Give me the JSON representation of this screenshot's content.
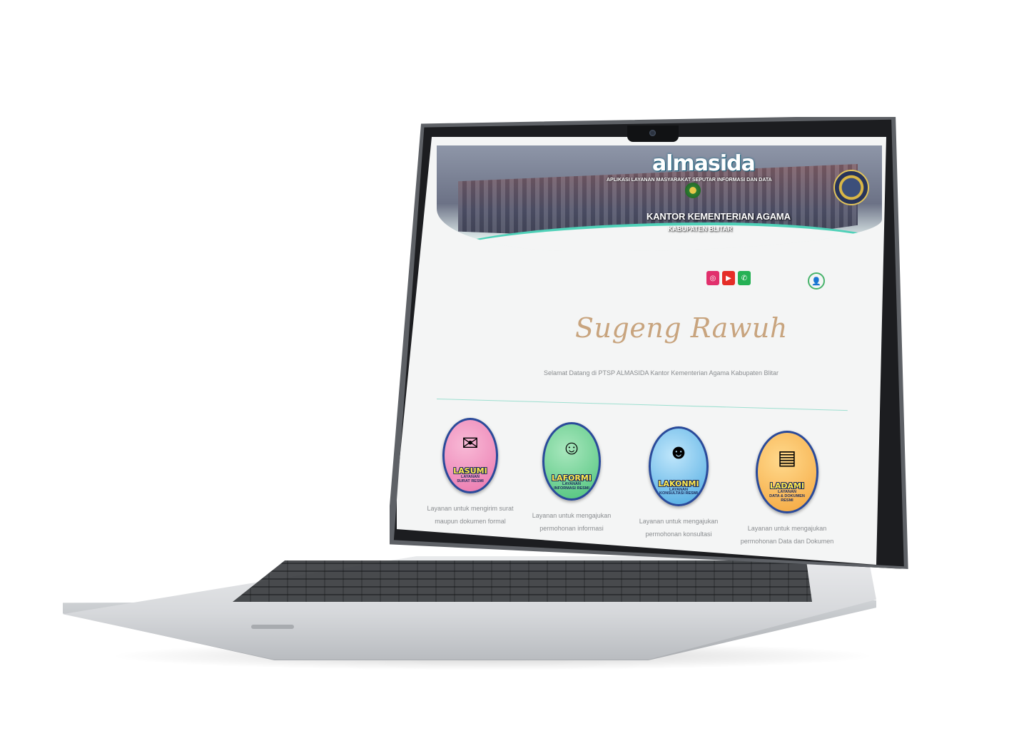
{
  "banner": {
    "logo": "almasida",
    "tagline": "APLIKASI LAYANAN MASYARAKAT SEPUTAR INFORMASI DAN DATA",
    "office_name": "KANTOR KEMENTERIAN AGAMA",
    "office_city": "KABUPATEN BLITAR"
  },
  "socials": [
    {
      "name": "instagram-icon",
      "glyph": "◎"
    },
    {
      "name": "youtube-icon",
      "glyph": "▶"
    },
    {
      "name": "whatsapp-icon",
      "glyph": "✆"
    }
  ],
  "user_icon": "user-icon",
  "greeting": "Sugeng Rawuh",
  "welcome": "Selamat Datang di PTSP ALMASIDA Kantor Kementerian Agama Kabupaten Blitar",
  "services": [
    {
      "title": "LASUMI",
      "subtitle": "LAYANAN\nSURAT RESMI",
      "icon": "envelope-icon",
      "glyph": "✉",
      "description": "Layanan untuk mengirim surat maupun dokumen formal"
    },
    {
      "title": "LAFORMI",
      "subtitle": "LAYANAN\nINFORMASI RESMI",
      "icon": "support-agent-icon",
      "glyph": "☺",
      "description": "Layanan untuk mengajukan permohonan informasi"
    },
    {
      "title": "LAKONMI",
      "subtitle": "LAYANAN\nKONSULTASI RESMI",
      "icon": "consultant-icon",
      "glyph": "☻",
      "description": "Layanan untuk mengajukan permohonan konsultasi"
    },
    {
      "title": "LADAMI",
      "subtitle": "LAYANAN\nDATA & DOKUMEN\nRESMI",
      "icon": "documents-icon",
      "glyph": "▤",
      "description": "Layanan untuk mengajukan permohonan Data dan Dokumen"
    }
  ],
  "colors": {
    "accent": "#4fd1b8",
    "greeting": "#c8a47e",
    "instagram": "#e1306c",
    "youtube": "#e52d27",
    "whatsapp": "#25b155"
  }
}
